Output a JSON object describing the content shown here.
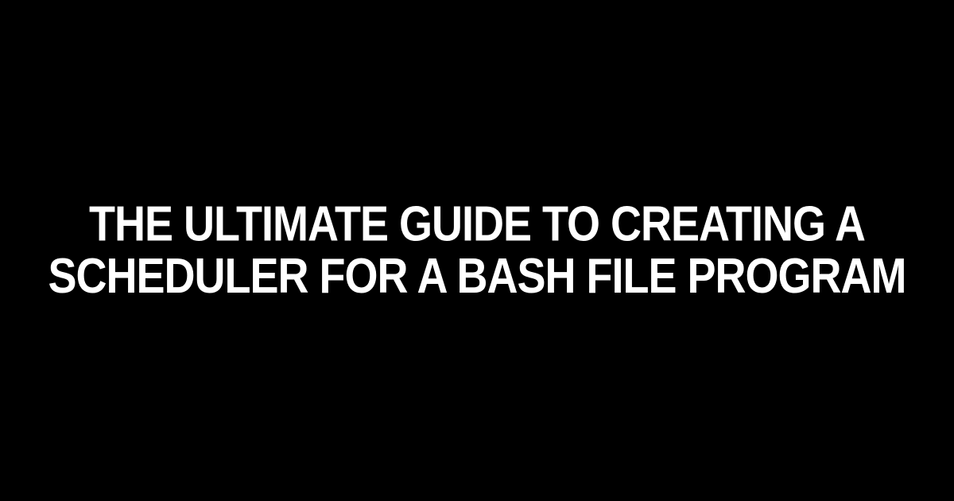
{
  "title": "THE ULTIMATE GUIDE TO CREATING A SCHEDULER FOR A BASH FILE PROGRAM"
}
